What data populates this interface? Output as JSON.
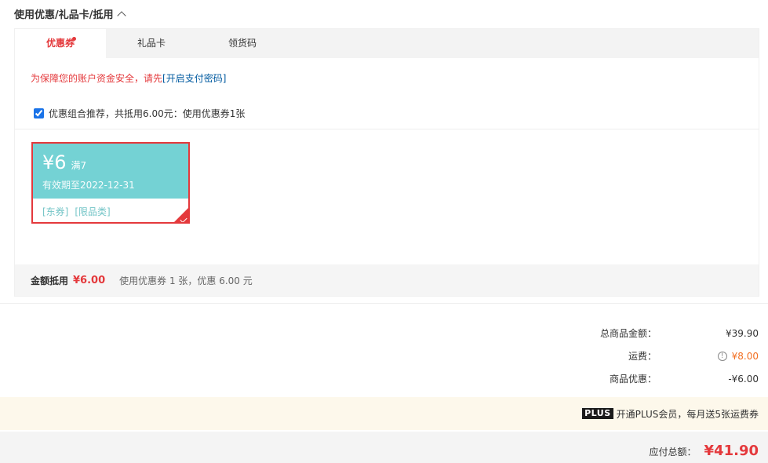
{
  "section": {
    "title": "使用优惠/礼品卡/抵用"
  },
  "tabs": [
    {
      "label": "优惠券"
    },
    {
      "label": "礼品卡"
    },
    {
      "label": "领货码"
    }
  ],
  "warning": {
    "text": "为保障您的账户资金安全，请先",
    "link": "[开启支付密码]"
  },
  "combo": {
    "label": "优惠组合推荐，共抵用6.00元：使用优惠券1张",
    "checked": true
  },
  "coupon": {
    "value": "¥6",
    "condition": "满7",
    "expire": "有效期至2022-12-31",
    "tags": [
      "[东券]",
      "[限品类]"
    ],
    "color": "#74d2d4"
  },
  "summary": {
    "label": "金额抵用",
    "amount": "¥6.00",
    "desc": "使用优惠券 1 张，优惠 6.00 元"
  },
  "totals": [
    {
      "label": "总商品金额：",
      "value": "¥39.90"
    },
    {
      "label": "运费：",
      "value": "¥8.00"
    },
    {
      "label": "商品优惠：",
      "value": "-¥6.00"
    }
  ],
  "plus": {
    "badge": "PLUS",
    "text": "开通PLUS会员，每月送5张运费券"
  },
  "pay": {
    "label": "应付总额：",
    "amount": "¥41.90"
  },
  "colors": {
    "accent": "#e4393c",
    "coupon": "#74d2d4",
    "freight": "#f26f21"
  }
}
